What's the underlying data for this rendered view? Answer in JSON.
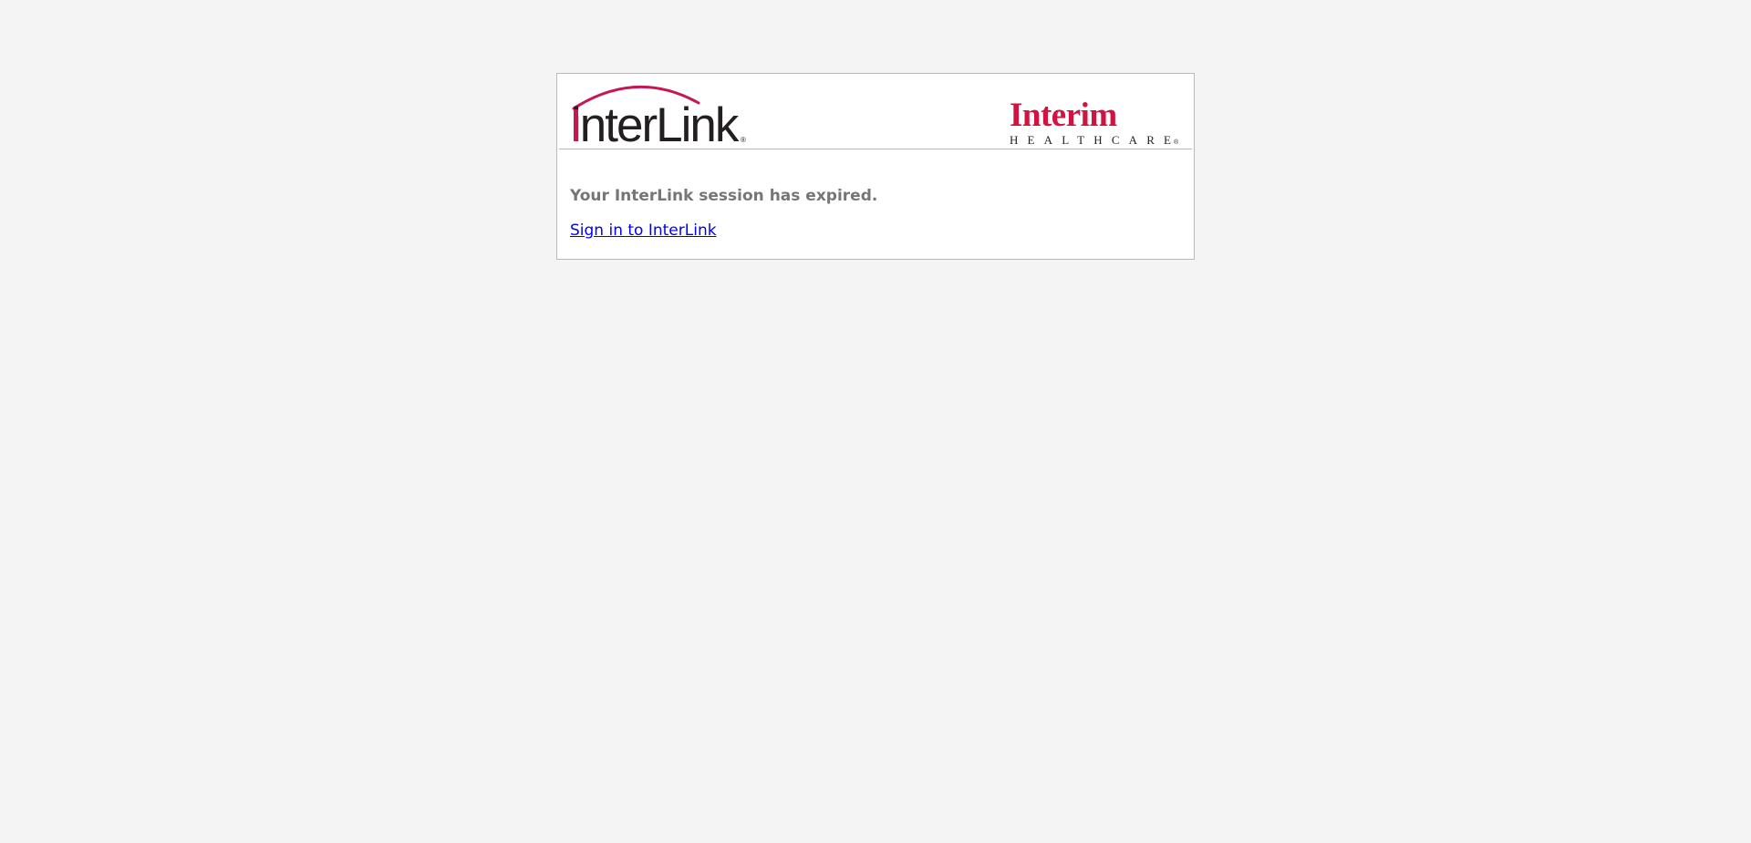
{
  "header": {
    "interlink_logo": {
      "text_main": "interLink",
      "text_registered": "®",
      "colors": {
        "arc": "#c8164e",
        "accent_i": "#c8164e",
        "text": "#231f20"
      }
    },
    "interim_logo": {
      "text_main": "Interim",
      "text_sub": "HEALTHCARE",
      "text_registered": "®",
      "colors": {
        "main": "#d2123f",
        "sub": "#231f20"
      }
    }
  },
  "main": {
    "message": "Your InterLink session has expired.",
    "signin_link_label": "Sign in to InterLink"
  }
}
